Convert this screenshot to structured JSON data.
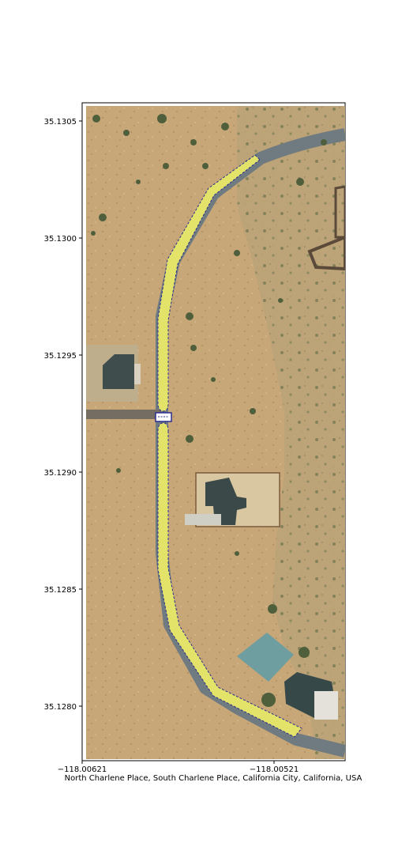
{
  "map": {
    "caption": "North Charlene Place, South Charlene Place, California City, California, USA",
    "basemap": "satellite imagery",
    "x_ticks": [
      "−118.00621",
      "−118.00521"
    ],
    "y_ticks": [
      "35.1305",
      "35.1300",
      "35.1295",
      "35.1290",
      "35.1285",
      "35.1280"
    ],
    "colors": {
      "road_fill": "#e3e36a",
      "road_outline": "#2b2d8f",
      "ground": "#c9a97a",
      "vegetation": "#4f5f3c",
      "pavement": "#6f7b80"
    },
    "features": [
      {
        "type": "road-polygon",
        "name": "north-charlene-place"
      },
      {
        "type": "road-polygon",
        "name": "south-charlene-place"
      },
      {
        "type": "junction-marker",
        "name": "place-split-marker"
      }
    ]
  }
}
